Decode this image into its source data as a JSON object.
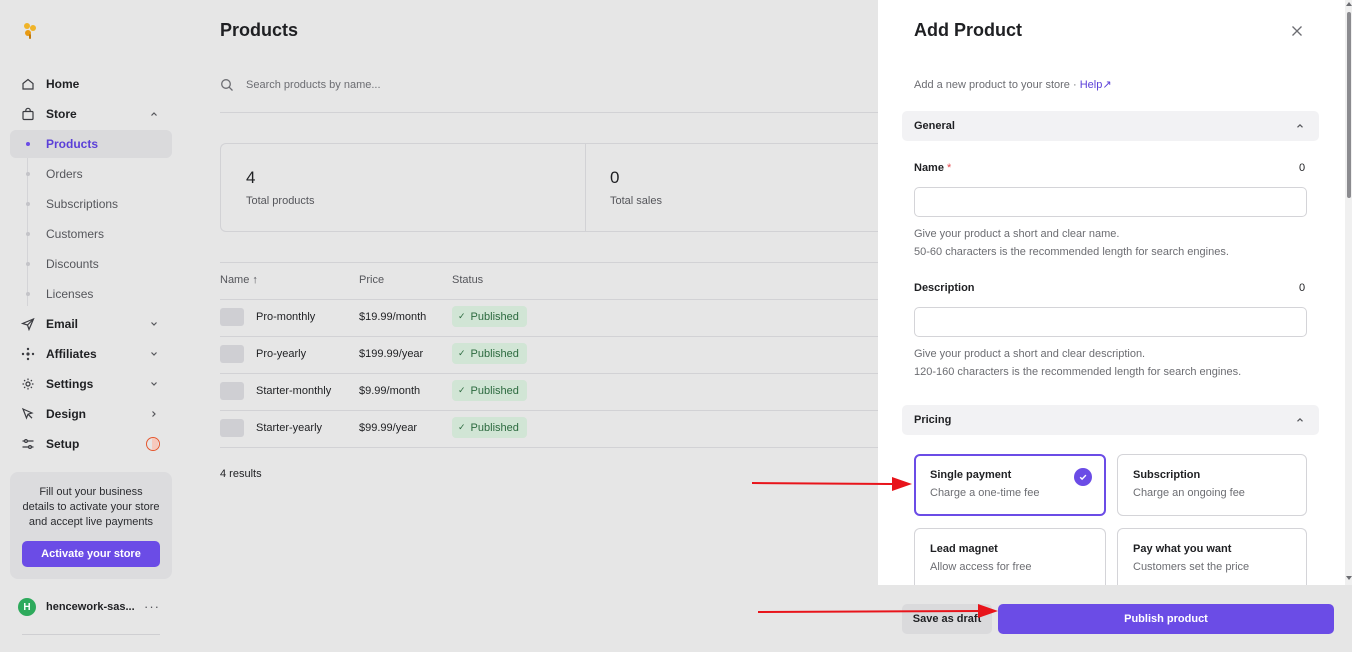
{
  "sidebar": {
    "nav": {
      "home": "Home",
      "store": "Store",
      "email": "Email",
      "affiliates": "Affiliates",
      "settings": "Settings",
      "design": "Design",
      "setup": "Setup"
    },
    "store_items": [
      "Products",
      "Orders",
      "Subscriptions",
      "Customers",
      "Discounts",
      "Licenses"
    ],
    "active_item": "Products",
    "promo": {
      "text": "Fill out your business details to activate your store and accept live payments",
      "button": "Activate your store"
    },
    "account": {
      "initial": "H",
      "name": "hencework-sas...",
      "more": "···"
    }
  },
  "main": {
    "title": "Products",
    "search_placeholder": "Search products by name...",
    "stats": [
      {
        "value": "4",
        "label": "Total products"
      },
      {
        "value": "0",
        "label": "Total sales"
      }
    ],
    "columns": {
      "name": "Name ↑",
      "price": "Price",
      "status": "Status"
    },
    "rows": [
      {
        "name": "Pro-monthly",
        "price": "$19.99/month",
        "status": "Published"
      },
      {
        "name": "Pro-yearly",
        "price": "$199.99/year",
        "status": "Published"
      },
      {
        "name": "Starter-monthly",
        "price": "$9.99/month",
        "status": "Published"
      },
      {
        "name": "Starter-yearly",
        "price": "$99.99/year",
        "status": "Published"
      }
    ],
    "results": "4 results"
  },
  "drawer": {
    "title": "Add Product",
    "subtitle": "Add a new product to your store · ",
    "help_link": "Help↗",
    "general": {
      "section_title": "General",
      "name_label": "Name",
      "name_required": "*",
      "name_count": "0",
      "name_value": "",
      "name_help_1": "Give your product a short and clear name.",
      "name_help_2": "50-60 characters is the recommended length for search engines.",
      "description_label": "Description",
      "description_count": "0",
      "description_value": "",
      "description_help_1": "Give your product a short and clear description.",
      "description_help_2": "120-160 characters is the recommended length for search engines."
    },
    "pricing": {
      "section_title": "Pricing",
      "options": [
        {
          "title": "Single payment",
          "desc": "Charge a one-time fee",
          "selected": true
        },
        {
          "title": "Subscription",
          "desc": "Charge an ongoing fee",
          "selected": false
        },
        {
          "title": "Lead magnet",
          "desc": "Allow access for free",
          "selected": false
        },
        {
          "title": "Pay what you want",
          "desc": "Customers set the price",
          "selected": false
        }
      ]
    },
    "footer": {
      "draft": "Save as draft",
      "publish": "Publish product"
    }
  },
  "colors": {
    "accent": "#6b4ce6",
    "published_bg": "#d1e5d5",
    "published_text": "#2c6a3f",
    "annotation_arrow": "#e8141b"
  }
}
